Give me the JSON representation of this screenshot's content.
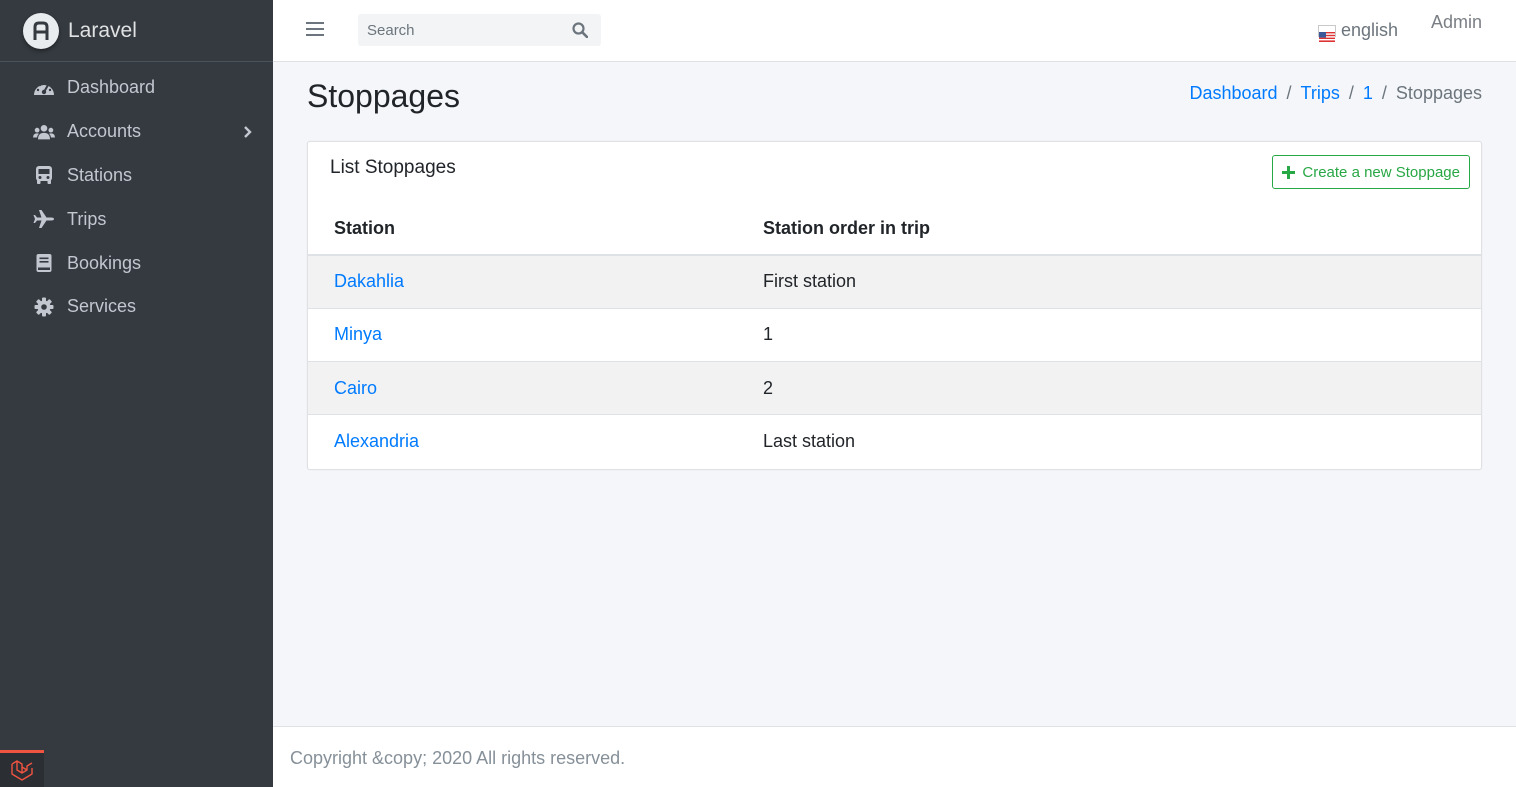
{
  "app": {
    "name": "Laravel"
  },
  "sidebar": {
    "items": [
      {
        "label": "Dashboard",
        "icon": "tachometer-icon"
      },
      {
        "label": "Accounts",
        "icon": "users-icon",
        "has_submenu": true
      },
      {
        "label": "Stations",
        "icon": "bus-icon"
      },
      {
        "label": "Trips",
        "icon": "plane-icon"
      },
      {
        "label": "Bookings",
        "icon": "book-icon"
      },
      {
        "label": "Services",
        "icon": "gear-icon"
      }
    ]
  },
  "topbar": {
    "search_placeholder": "Search",
    "language": "english",
    "user": "Admin"
  },
  "page": {
    "title": "Stoppages",
    "breadcrumb": [
      {
        "label": "Dashboard",
        "link": true
      },
      {
        "label": "Trips",
        "link": true
      },
      {
        "label": "1",
        "link": true
      },
      {
        "label": "Stoppages",
        "link": false
      }
    ]
  },
  "card": {
    "title": "List Stoppages",
    "create_label": "Create a new Stoppage",
    "columns": [
      "Station",
      "Station order in trip"
    ],
    "rows": [
      {
        "station": "Dakahlia",
        "order": "First station"
      },
      {
        "station": "Minya",
        "order": "1"
      },
      {
        "station": "Cairo",
        "order": "2"
      },
      {
        "station": "Alexandria",
        "order": "Last station"
      }
    ]
  },
  "footer": {
    "text": "Copyright &copy; 2020 All rights reserved."
  },
  "colors": {
    "sidebar": "#343a40",
    "link": "#007bff",
    "success": "#28a745",
    "laravel": "#f05340"
  }
}
